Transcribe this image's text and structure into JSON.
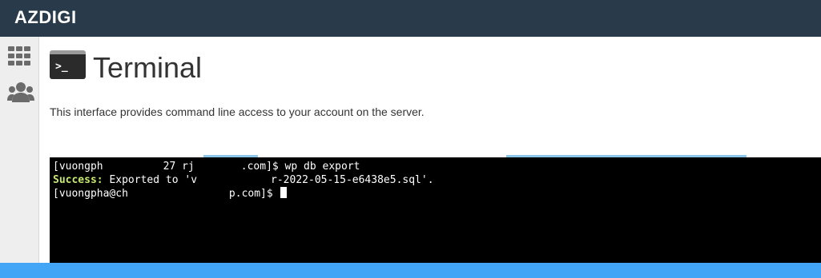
{
  "header": {
    "brand": "AZDIGI"
  },
  "sidebar": {
    "items": [
      {
        "name": "apps-grid-icon"
      },
      {
        "name": "users-icon"
      }
    ]
  },
  "page": {
    "title": "Terminal",
    "description": "This interface provides command line access to your account on the server."
  },
  "terminal": {
    "line1": {
      "prefix": "[vuongph",
      "mid": "27 rj",
      "after": ".com]$ wp db export"
    },
    "line2": {
      "label": "Success:",
      "text_a": " Exported to 'v",
      "text_b": "r-2022-05-15-e6438e5.sql'."
    },
    "line3": {
      "prefix": "[vuongpha@ch",
      "after": "p.com]$ "
    }
  },
  "colors": {
    "topbar": "#293a4a",
    "terminal_bg": "#000000",
    "success": "#c7e870",
    "bottom_bar": "#42a5f5"
  }
}
